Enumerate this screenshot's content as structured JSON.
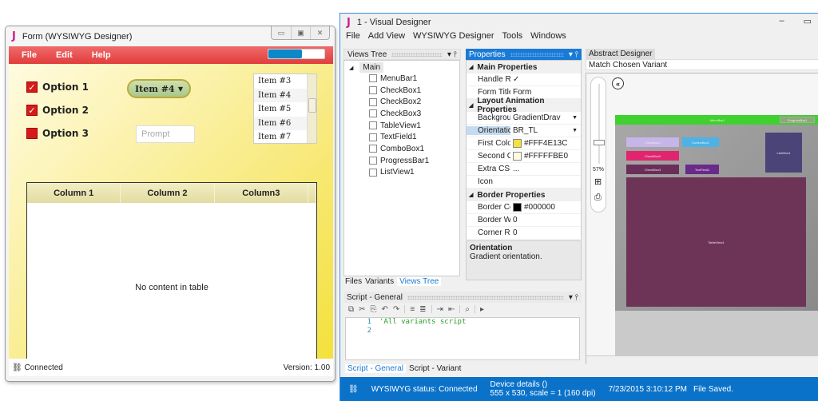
{
  "form_window": {
    "title": "Form (WYSIWYG Designer)",
    "logo": "J",
    "window_buttons": [
      "minimize-icon",
      "maximize-icon",
      "close-icon"
    ],
    "menu": [
      "File",
      "Edit",
      "Help"
    ],
    "progress_percent": 60,
    "checkboxes": [
      {
        "label": "Option 1",
        "checked": true
      },
      {
        "label": "Option 2",
        "checked": true
      },
      {
        "label": "Option 3",
        "checked": false
      }
    ],
    "combo": {
      "value": "Item #4"
    },
    "textfield": {
      "placeholder": "Prompt",
      "value": ""
    },
    "list_items": [
      "Item #3",
      "Item #4",
      "Item #5",
      "Item #6",
      "Item #7"
    ],
    "table": {
      "columns": [
        "Column 1",
        "Column 2",
        "Column3"
      ],
      "empty_text": "No content in table"
    },
    "status": {
      "connection": "Connected",
      "version": "Version: 1.00"
    },
    "colors": {
      "menu": "#E23D3D",
      "gradient_first": "#FFF4E13C",
      "gradient_second": "#FFFFFBE0"
    }
  },
  "app": {
    "title": "1 - Visual Designer",
    "logo": "J",
    "menu": [
      "File",
      "Add View",
      "WYSIWYG Designer",
      "Tools",
      "Windows"
    ],
    "views_tree": {
      "header": "Views Tree",
      "root": "Main",
      "items": [
        "MenuBar1",
        "CheckBox1",
        "CheckBox2",
        "CheckBox3",
        "TableView1",
        "TextField1",
        "ComboBox1",
        "ProgressBar1",
        "ListView1"
      ],
      "tabs": [
        "Files",
        "Variants",
        "Views Tree"
      ],
      "active_tab": "Views Tree"
    },
    "properties": {
      "header": "Properties",
      "sections": [
        {
          "name": "Main Properties",
          "rows": [
            {
              "key": "Handle Resi",
              "value": "✓"
            },
            {
              "key": "Form Title",
              "value": "Form"
            }
          ]
        },
        {
          "name": "Layout Animation Properties",
          "rows": [
            {
              "key": "Background",
              "value": "GradientDrav"
            },
            {
              "key": "Orientatic",
              "value": "BR_TL"
            },
            {
              "key": "First Colo",
              "value": "#FFF4E13C",
              "swatch": "#F4E13C"
            },
            {
              "key": "Second C",
              "value": "#FFFFFBE0",
              "swatch": "#FFFBE0"
            },
            {
              "key": "Extra CSS",
              "value": "..."
            },
            {
              "key": "Icon",
              "value": ""
            }
          ]
        },
        {
          "name": "Border Properties",
          "rows": [
            {
              "key": "Border Colo",
              "value": "#000000",
              "swatch": "#000000"
            },
            {
              "key": "Border Widt",
              "value": "0"
            },
            {
              "key": "Corner Radi",
              "value": "0"
            }
          ]
        }
      ],
      "description_title": "Orientation",
      "description_text": "Gradient orientation."
    },
    "script": {
      "header": "Script - General",
      "lines": [
        {
          "n": "1",
          "code": "'All variants script"
        },
        {
          "n": "2",
          "code": ""
        }
      ],
      "tabs": [
        "Script - General",
        "Script - Variant"
      ],
      "active_tab": "Script - General"
    },
    "abstract_designer": {
      "tab": "Abstract Designer",
      "variant": "Match Chosen Variant",
      "zoom_percent": "57%",
      "widgets": {
        "menubar": "MenuBar1",
        "progressbar": "ProgressBar1",
        "checkbox1": "CheckBox1",
        "combobox": "ComboBox1",
        "checkbox2": "CheckBox2",
        "checkbox3": "CheckBox3",
        "textfield": "TextField1",
        "listview": "ListView1",
        "tableview": "TableView1"
      }
    },
    "status": {
      "wysiwyg": "WYSIWYG status: Connected",
      "device_line1": "Device details ()",
      "device_line2": "555 x 530, scale = 1 (160 dpi)",
      "timestamp": "7/23/2015 3:10:12 PM",
      "message": "File Saved."
    }
  }
}
